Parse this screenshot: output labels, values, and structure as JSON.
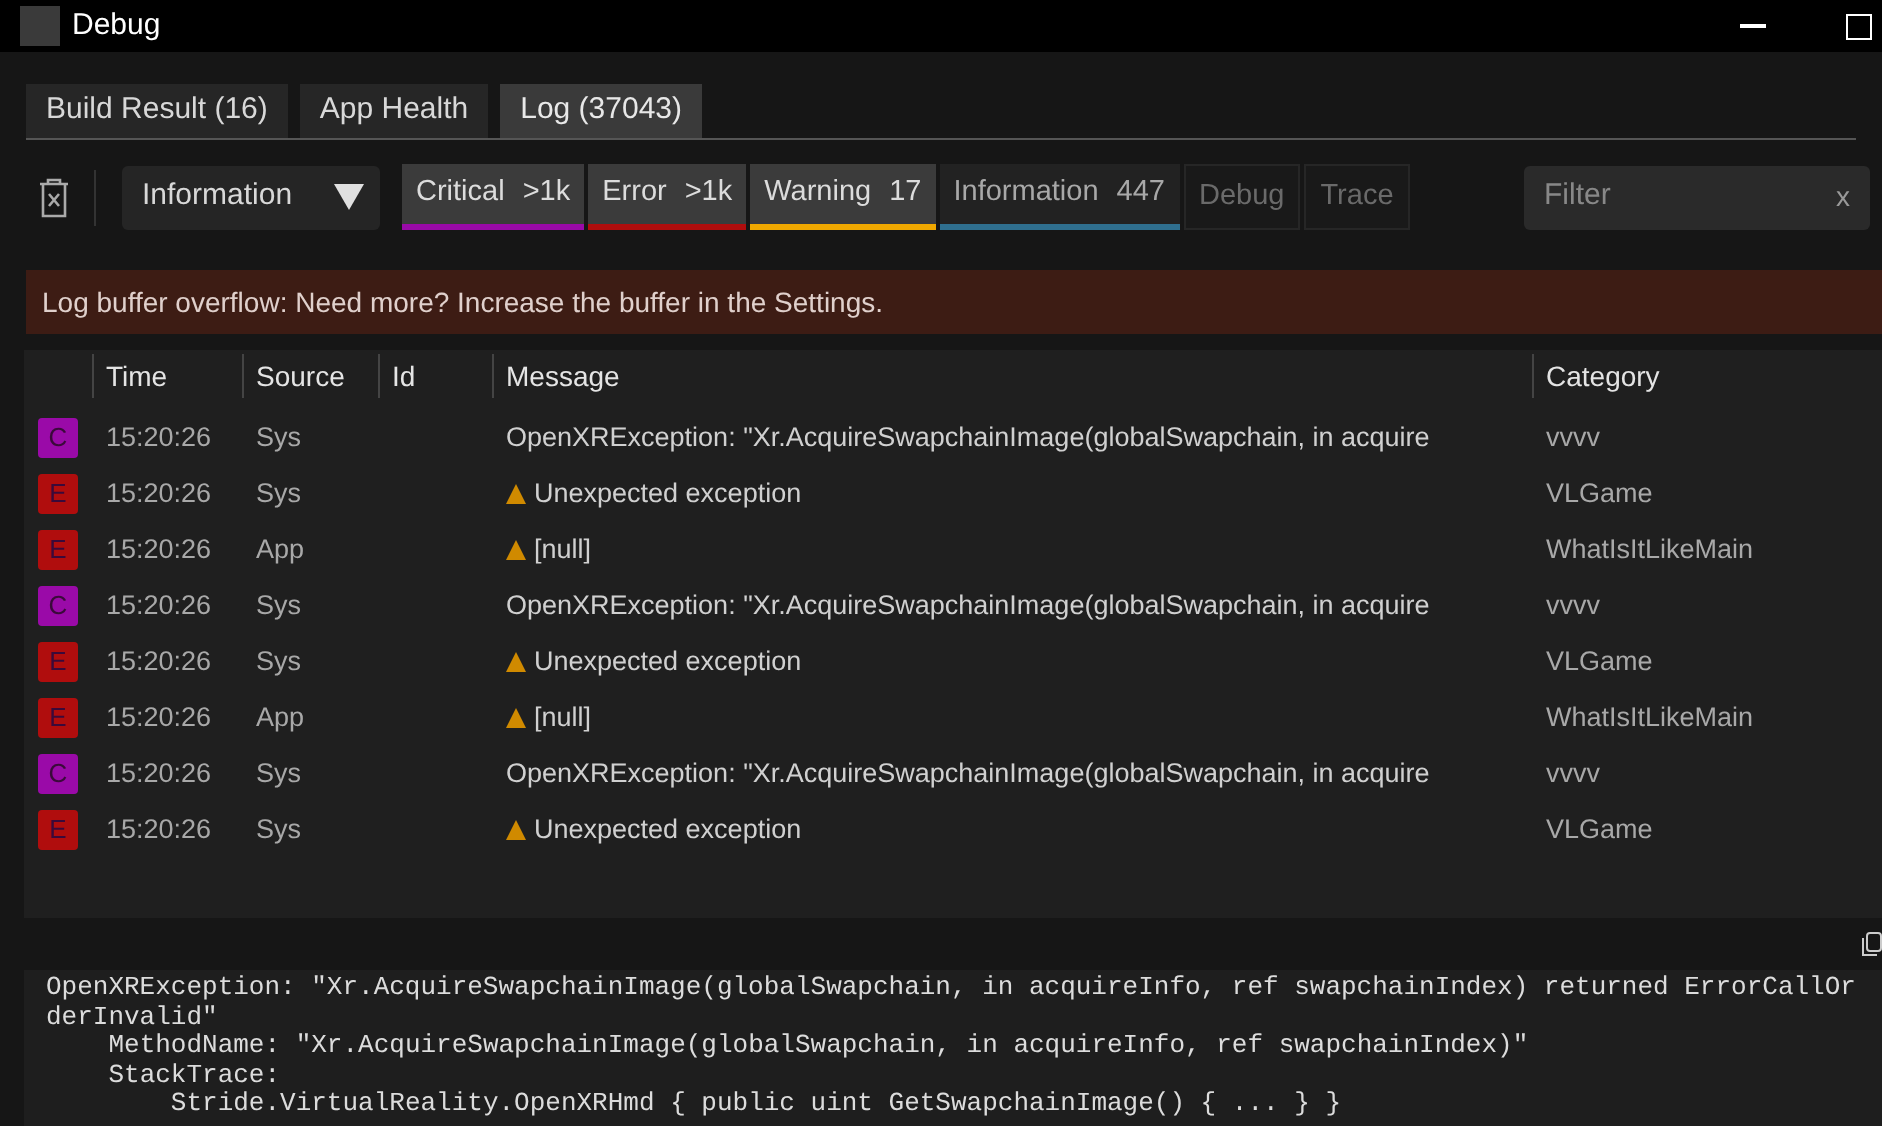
{
  "window": {
    "title": "Debug"
  },
  "tabs": [
    {
      "label": "Build Result (16)",
      "selected": false
    },
    {
      "label": "App Health",
      "selected": false
    },
    {
      "label": "Log (37043)",
      "selected": true
    }
  ],
  "toolbar": {
    "level_dropdown": {
      "value": "Information"
    },
    "filters": [
      {
        "label": "Critical",
        "count": ">1k",
        "selected": true,
        "color": "#9a0aa8"
      },
      {
        "label": "Error",
        "count": ">1k",
        "selected": true,
        "color": "#b00d0d"
      },
      {
        "label": "Warning",
        "count": "17",
        "selected": true,
        "color": "#f0a800"
      },
      {
        "label": "Information",
        "count": "447",
        "selected": false,
        "color": "#2f6f8f"
      },
      {
        "label": "Debug",
        "selected": false
      },
      {
        "label": "Trace",
        "selected": false
      }
    ],
    "filter_field": {
      "placeholder": "Filter",
      "clear": "x"
    }
  },
  "banner": {
    "text": "Log buffer overflow: Need more? Increase the buffer in the Settings."
  },
  "table": {
    "columns": [
      "Time",
      "Source",
      "Id",
      "Message",
      "Category"
    ],
    "rows": [
      {
        "level": "C",
        "color": "#9a0aa8",
        "time": "15:20:26",
        "source": "Sys",
        "warning": false,
        "message": "OpenXRException: \"Xr.AcquireSwapchainImage(globalSwapchain, in acquire",
        "category": "vvvv"
      },
      {
        "level": "E",
        "color": "#b00d0d",
        "time": "15:20:26",
        "source": "Sys",
        "warning": true,
        "message": "Unexpected exception",
        "category": "VLGame"
      },
      {
        "level": "E",
        "color": "#b00d0d",
        "time": "15:20:26",
        "source": "App",
        "warning": true,
        "message": "[null]",
        "category": "WhatIsItLikeMain"
      },
      {
        "level": "C",
        "color": "#9a0aa8",
        "time": "15:20:26",
        "source": "Sys",
        "warning": false,
        "message": "OpenXRException: \"Xr.AcquireSwapchainImage(globalSwapchain, in acquire",
        "category": "vvvv"
      },
      {
        "level": "E",
        "color": "#b00d0d",
        "time": "15:20:26",
        "source": "Sys",
        "warning": true,
        "message": "Unexpected exception",
        "category": "VLGame"
      },
      {
        "level": "E",
        "color": "#b00d0d",
        "time": "15:20:26",
        "source": "App",
        "warning": true,
        "message": "[null]",
        "category": "WhatIsItLikeMain"
      },
      {
        "level": "C",
        "color": "#9a0aa8",
        "time": "15:20:26",
        "source": "Sys",
        "warning": false,
        "message": "OpenXRException: \"Xr.AcquireSwapchainImage(globalSwapchain, in acquire",
        "category": "vvvv"
      },
      {
        "level": "E",
        "color": "#b00d0d",
        "time": "15:20:26",
        "source": "Sys",
        "warning": true,
        "message": "Unexpected exception",
        "category": "VLGame"
      }
    ]
  },
  "details": {
    "lines": [
      "OpenXRException: \"Xr.AcquireSwapchainImage(globalSwapchain, in acquireInfo, ref swapchainIndex) returned ErrorCallOrderInvalid\"",
      "    MethodName: \"Xr.AcquireSwapchainImage(globalSwapchain, in acquireInfo, ref swapchainIndex)\"",
      "    StackTrace:",
      "        Stride.VirtualReality.OpenXRHmd { public uint GetSwapchainImage() { ... } }"
    ]
  }
}
